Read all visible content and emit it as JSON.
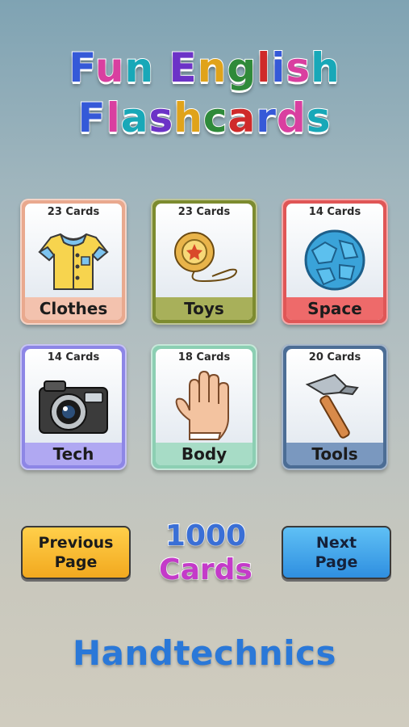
{
  "title": {
    "line1": "Fun English",
    "line2": "Flashcards",
    "letter_colors": [
      "#3559d8",
      "#d93fa0",
      "#18a8b8",
      "#6c33c7",
      "#e0a31a",
      "#2f8a3a",
      "#cf2a2a"
    ]
  },
  "categories": [
    {
      "count": "23 Cards",
      "label": "Clothes",
      "icon": "shirt-icon",
      "frame": "#e9a98e",
      "band": "#f3c2ae"
    },
    {
      "count": "23 Cards",
      "label": "Toys",
      "icon": "yoyo-icon",
      "frame": "#7d8b2f",
      "band": "#a8b05a"
    },
    {
      "count": "14 Cards",
      "label": "Space",
      "icon": "planet-icon",
      "frame": "#e05656",
      "band": "#ee6a6a"
    },
    {
      "count": "14 Cards",
      "label": "Tech",
      "icon": "camera-icon",
      "frame": "#8d86e6",
      "band": "#b0a8f2"
    },
    {
      "count": "18 Cards",
      "label": "Body",
      "icon": "hand-icon",
      "frame": "#8ccfb3",
      "band": "#a7dcc6"
    },
    {
      "count": "20 Cards",
      "label": "Tools",
      "icon": "hammer-icon",
      "frame": "#4c6d95",
      "band": "#7a98bf"
    }
  ],
  "buttons": {
    "previous": {
      "line1": "Previous",
      "line2": "Page",
      "color": "#f2b52a"
    },
    "next": {
      "line1": "Next",
      "line2": "Page",
      "color": "#3aa6e8"
    }
  },
  "total": {
    "number": "1000",
    "word": "Cards"
  },
  "footer": {
    "brand": "Handtechnics"
  }
}
